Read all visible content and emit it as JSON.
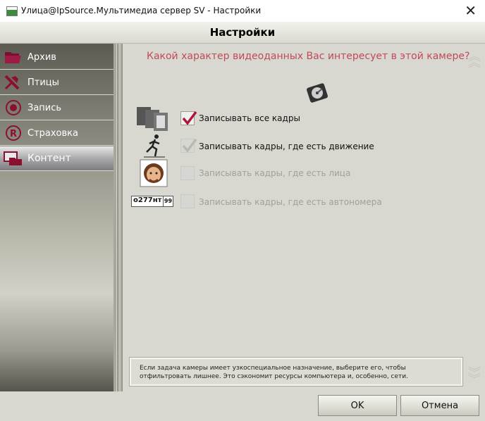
{
  "window": {
    "title": "Улица@IpSource.Мультимедиа сервер SV - Настройки"
  },
  "header": {
    "title": "Настройки"
  },
  "sidebar": {
    "items": [
      {
        "label": "Архив",
        "icon": "folder-icon"
      },
      {
        "label": "Птицы",
        "icon": "tools-icon"
      },
      {
        "label": "Запись",
        "icon": "record-icon"
      },
      {
        "label": "Страховка",
        "icon": "registered-icon"
      },
      {
        "label": "Контент",
        "icon": "content-icon",
        "active": true
      }
    ]
  },
  "main": {
    "question": "Какой характер видеоданных Вас интересует в этой камере?",
    "options": [
      {
        "label": "Записывать все кадры",
        "checked": true,
        "enabled": true,
        "icon": "film-frames-icon"
      },
      {
        "label": "Записывать кадры, где есть движение",
        "checked": true,
        "enabled": false,
        "icon": "running-man-icon"
      },
      {
        "label": "Записывать кадры, где есть лица",
        "checked": false,
        "enabled": false,
        "icon": "face-icon"
      },
      {
        "label": "Записывать кадры, где есть автономера",
        "checked": false,
        "enabled": false,
        "icon": "license-plate-icon"
      }
    ],
    "plate": {
      "number": "о277нт",
      "region": "99"
    },
    "note": "Если задача камеры имеет узкоспециальное назначение, выберите его, чтобы отфильтровать лишнее. Это сэкономит ресурсы компьютера и, особенно, сети."
  },
  "footer": {
    "ok_label": "OK",
    "cancel_label": "Отмена"
  },
  "colors": {
    "question": "#c04a5b",
    "accent": "#8b1a3a",
    "checkmark": "#b0153e"
  }
}
